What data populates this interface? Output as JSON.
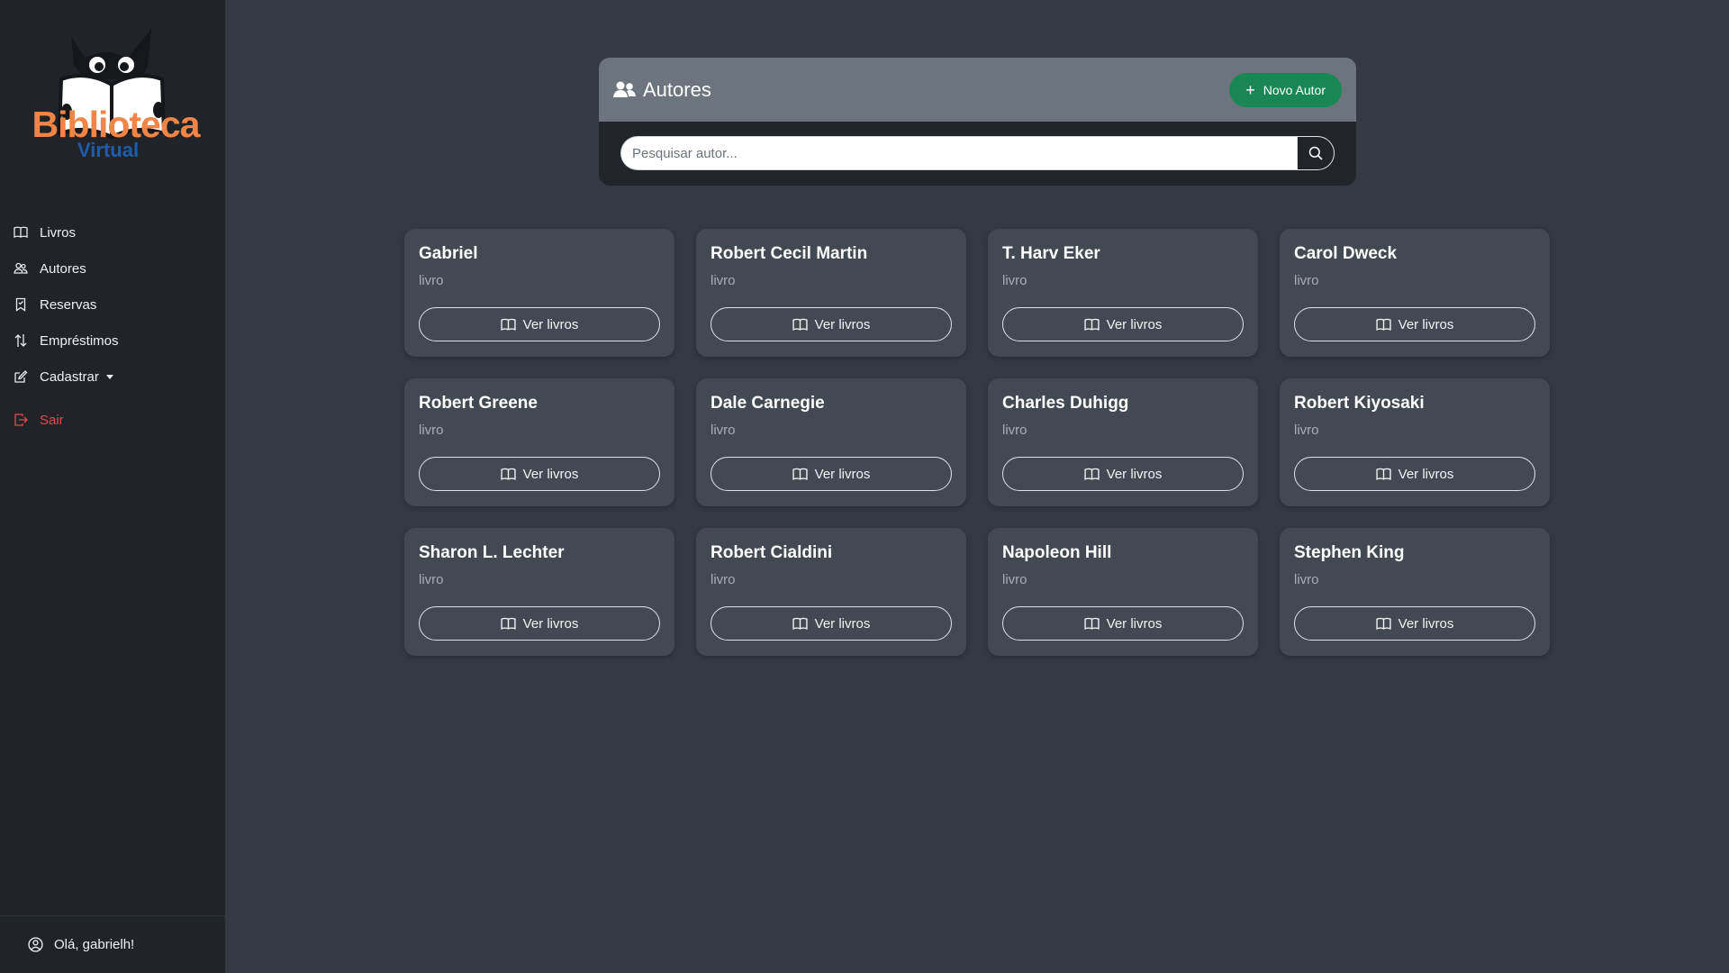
{
  "brand": {
    "line1": "Biblioteca",
    "line2": "Virtual"
  },
  "sidebar": {
    "items": [
      {
        "label": "Livros",
        "icon": "book-icon"
      },
      {
        "label": "Autores",
        "icon": "people-icon"
      },
      {
        "label": "Reservas",
        "icon": "bookmark-icon"
      },
      {
        "label": "Empréstimos",
        "icon": "arrows-updown-icon"
      },
      {
        "label": "Cadastrar",
        "icon": "pencil-square-icon"
      }
    ],
    "logout": "Sair",
    "greeting": "Olá, gabrielh!"
  },
  "panel": {
    "title": "Autores",
    "new_button": "Novo Autor",
    "search_placeholder": "Pesquisar autor..."
  },
  "authors": [
    {
      "name": "Gabriel",
      "sub": "livro",
      "button": "Ver livros"
    },
    {
      "name": "Robert Cecil Martin",
      "sub": "livro",
      "button": "Ver livros"
    },
    {
      "name": "T. Harv Eker",
      "sub": "livro",
      "button": "Ver livros"
    },
    {
      "name": "Carol Dweck",
      "sub": "livro",
      "button": "Ver livros"
    },
    {
      "name": "Robert Greene",
      "sub": "livro",
      "button": "Ver livros"
    },
    {
      "name": "Dale Carnegie",
      "sub": "livro",
      "button": "Ver livros"
    },
    {
      "name": "Charles Duhigg",
      "sub": "livro",
      "button": "Ver livros"
    },
    {
      "name": "Robert Kiyosaki",
      "sub": "livro",
      "button": "Ver livros"
    },
    {
      "name": "Sharon L. Lechter",
      "sub": "livro",
      "button": "Ver livros"
    },
    {
      "name": "Robert Cialdini",
      "sub": "livro",
      "button": "Ver livros"
    },
    {
      "name": "Napoleon Hill",
      "sub": "livro",
      "button": "Ver livros"
    },
    {
      "name": "Stephen King",
      "sub": "livro",
      "button": "Ver livros"
    }
  ],
  "colors": {
    "sidebar_bg": "#202429",
    "page_bg": "#343a43",
    "card_bg": "#434952",
    "accent_green": "#198754",
    "logout_red": "#e3494f",
    "brand_orange": "#f08547",
    "brand_blue": "#1f5cab"
  }
}
